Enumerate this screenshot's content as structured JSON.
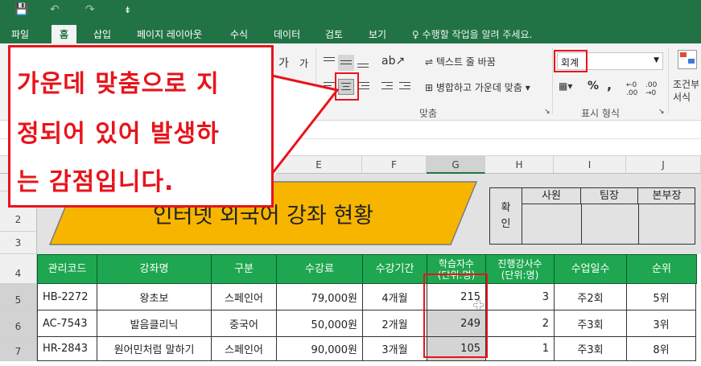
{
  "quick_access": {
    "save": "💾",
    "undo": "↶",
    "redo": "↷",
    "customize": "⇟"
  },
  "tabs": [
    "파일",
    "홈",
    "삽입",
    "페이지 레이아웃",
    "수식",
    "데이터",
    "검토",
    "보기"
  ],
  "active_tab": "홈",
  "tell_me": "수행할 작업을 알려 주세요.",
  "ribbon": {
    "font_grow": "가",
    "font_shrink": "가",
    "wrap_text": "텍스트 줄 바꿈",
    "merge_center": "병합하고 가운데 맞춤",
    "alignment_label": "맞춤",
    "number_format_value": "회계",
    "percent": "%",
    "comma": ",",
    "number_label": "표시 형식",
    "conditional_format_line1": "조건부",
    "conditional_format_line2": "서식"
  },
  "columns": [
    "E",
    "F",
    "G",
    "H",
    "I",
    "J"
  ],
  "rows": [
    "2",
    "3",
    "4",
    "5",
    "6",
    "7"
  ],
  "sheet": {
    "title": "인터넷 외국어 강좌 현황",
    "approval": {
      "label": "확인",
      "roles": [
        "사원",
        "팀장",
        "본부장"
      ]
    },
    "headers": [
      "관리코드",
      "강좌명",
      "구분",
      "수강료",
      "수강기간",
      "학습자수\n(단위:명)",
      "진행강사수\n(단위:명)",
      "수업일수",
      "순위"
    ],
    "data": [
      [
        "HB-2272",
        "왕초보",
        "스페인어",
        "79,000원",
        "4개월",
        "215",
        "3",
        "주2회",
        "5위"
      ],
      [
        "AC-7543",
        "발음클리닉",
        "중국어",
        "50,000원",
        "2개월",
        "249",
        "2",
        "주3회",
        "3위"
      ],
      [
        "HR-2843",
        "원어민처럼 말하기",
        "스페인어",
        "90,000원",
        "3개월",
        "105",
        "1",
        "주3회",
        "8위"
      ]
    ]
  },
  "callout": {
    "line1": "가운데 맞춤으로 지",
    "line2": "정되어 있어 발생하",
    "line3": "는 감점입니다."
  },
  "colors": {
    "excel_green": "#217346",
    "header_green": "#1ea750",
    "title_fill": "#f7b500",
    "annotation_red": "#e8141b"
  }
}
